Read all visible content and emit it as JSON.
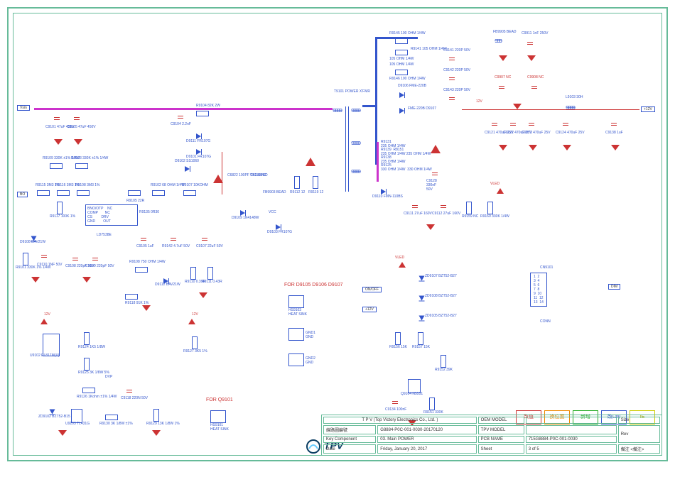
{
  "title_block": {
    "company": "T P V   (Top   Victory   Electronics   Co.,   Ltd. )",
    "row1_label": "線路圖編號",
    "row1_value": "G8884-P0C-001-0030-20170120",
    "row2_label": "Key Component",
    "row2_value": "03. Main POWER",
    "row3_label": "Date",
    "row3_value": "Friday, January 20, 2017",
    "oem_model_label": "OEM MODEL",
    "oem_model_value": "",
    "tpv_model_label": "TPV MODEL",
    "tpv_model_value": "",
    "pcb_name_label": "PCB NAME",
    "pcb_name_value": "715G8884-P0C-001-0030",
    "sheet_label": "Sheet",
    "sheet_value": "3   of    5",
    "size_label": "Size",
    "rev_label": "Rev",
    "note_label": "備注",
    "note_value": "<備注>"
  },
  "legend": {
    "a": "改值",
    "b": "換位置",
    "c": "新增",
    "d": "改Lay",
    "e": "IE"
  },
  "ports": {
    "vsin_l": "Vsin",
    "bo": "BO",
    "p12v": "+12V",
    "p12v2": "+12V",
    "vled": "VLED",
    "vled2": "VLED",
    "onoff": "ON/OFF",
    "dim": "DIM",
    "twelve": "12V",
    "twelve2": "12V",
    "vcc": "VCC"
  },
  "notes": {
    "for_q9101": "FOR Q9101",
    "for_d9105": "FOR D9105 D9106 D9107",
    "hs9101": "HS9101\nHEAT SINK",
    "hs9103": "HS9103\nHEAT SINK",
    "gnd1": "GND1\nGND",
    "gnd2": "GND2\nGND",
    "dvp": "DVP"
  },
  "refs": {
    "t9101": "T9101\nPOWER X'FMR",
    "c9104": "C9104\n2.2nF",
    "r9104": "R9104\n82K 2W",
    "d9111": "D9111\nFR107G",
    "d9101": "D9101\nFR107G",
    "d9102": "D9102\nSS1060",
    "d9109": "D9109\n1N4148W",
    "d9103": "D9103\nFR107G",
    "c6822": "C6822  100PF\nTK3.68/SD",
    "c9119": "C9119\nNC",
    "r9112": "R9112\n12",
    "r9119": "R9119\n12",
    "fb9903": "FB9903\nBEAD",
    "c9101": "C9101\n47uF 450V",
    "c9105b": "C9105\n47uF 450V",
    "r9109": "R9109\n330K ±1% 1/4W",
    "r9103": "R9103\n330K ±1% 1/4W",
    "r9115": "R9115\n3M3 1%",
    "r9116": "R9116\n3M3 1%",
    "r9108b": "R9108\n3M3 1%",
    "r9117": "R9117\n100K 1%",
    "r9101": "R9101\n330K 1% 1/4W",
    "c9110": "C9110\n1NF 50V",
    "d9108": "D9108\nBAV21W",
    "r9105": "R9105\n22R",
    "r9102": "R9102\n68 OHM 1/4W",
    "r9107": "R9107\n10KOHM",
    "r9135": "R9135  0R30",
    "c9105": "C9105\n1uF",
    "r9142": "R9142\n4.7uF 50V",
    "c9107": "C9107\n22uF 50V",
    "c9108": "C9108\n220pF 50V",
    "c9109": "C9109\n220pF 50V",
    "r9108": "R9108\n750 OHM 1/4W",
    "r9110": "R9110\n0.39R",
    "r9111": "R9111\n0.43R",
    "r9118": "R9118\n91K 1%",
    "d9112": "D9112\nBAV21W",
    "r9124": "R9124\n1K5 1/8W",
    "r9125": "R9125\n3K 1/8W 5%",
    "r9126": "R9126\n1Kohm ±1% 1/4W",
    "c9118": "C9118\n220N 50V",
    "u9102": "U9102\nEL817M(X)",
    "u9103": "U9103\nTL431G",
    "zd9102": "ZD9102\nBZT52-B15",
    "r9130": "R9130\n3K 1/8W ±1%",
    "r9129": "R9129\n13K 1/8W 1%",
    "r9127": "R9127\n3K5 1%",
    "ic9101_name": "LD7538E",
    "ic9101_pins": "BNO/OTP    NC\nCOMP       NC\nCS         DRV\nGND        OUT",
    "r9145": "R9145\n100 OHM 1/4W",
    "r9141": "R9141\n105 OHM 1/4W",
    "r9141b": "105 OHM 1/4W",
    "r9141c": "105 OHM 1/4W",
    "r9146": "R9146\n100 OHM 1/4W",
    "c9141": "C9141\n220P 50V",
    "c9142": "C9142\n220P 50V",
    "c9143": "C9143\n220P 50V",
    "d9106": "D9106\nFME-220B",
    "d9105": "FME-220B\nD9107",
    "d9110": "D9110\nFMN-110BS",
    "r9131_block": "R9131\n235 OHM 1/4W\nR9139  R8151\n235 OHM 1/4W 235 OHM 1/4W\nR9138\n235 OHM 1/4W\nR9125\n330 OHM 1/4W  330 OHM 1/4W",
    "c9128": "C9128\n330nF\n50V",
    "c9111": "C9111\n27uF 160V",
    "c9112": "C9112\n27uF 160V",
    "r9159": "R9159\nNC",
    "r9160": "R9160\n330K 1/4W",
    "fb9905": "FB9905\nBEAD",
    "c9911": "C9911\n1nF 250V",
    "c9907": "C9907\nNC",
    "c9908": "C9908\nNC",
    "l9103": "L9103\n30H",
    "c9121_series": "C9121\n470uF 25V",
    "c9122": "C9122\n470uF 25V",
    "c9872": "C9872\n470uF 25V",
    "c9124": "C9124\n470uF 25V",
    "c9138": "C9138\n1uF",
    "zd9107": "ZD9107\nBZT52-B27",
    "zd9108": "ZD9108\nBZT52-B27",
    "zd9105": "ZD9105\nBZT52-B27",
    "r9156": "R9156\n15K",
    "r9157": "R9157\n15K",
    "r9152": "R9152\n39K",
    "q9104": "Q9104\nN5551",
    "c9134": "C9134\n100nF",
    "r9151": "R9151\n330K",
    "cn9101": "CN9101",
    "cn9101_pins": "1  2\n3  4\n5  6\n7  8\n9  10\n11  12\n13  14",
    "conn": "CONN"
  }
}
